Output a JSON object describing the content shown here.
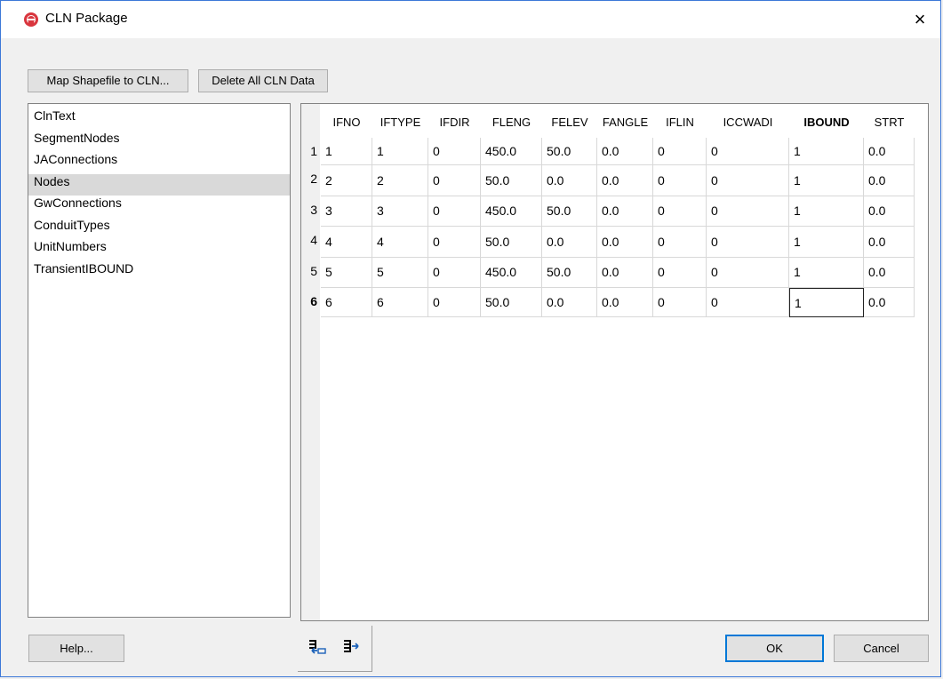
{
  "window": {
    "title": "CLN Package",
    "close_label": "×"
  },
  "toolbar": {
    "map_label": "Map Shapefile to CLN...",
    "delete_label": "Delete All CLN Data"
  },
  "sidebar": {
    "items": [
      {
        "label": "ClnText"
      },
      {
        "label": "SegmentNodes"
      },
      {
        "label": "JAConnections"
      },
      {
        "label": "Nodes"
      },
      {
        "label": "GwConnections"
      },
      {
        "label": "ConduitTypes"
      },
      {
        "label": "UnitNumbers"
      },
      {
        "label": "TransientIBOUND"
      }
    ],
    "selected_index": 3
  },
  "grid": {
    "columns": [
      "IFNO",
      "IFTYPE",
      "IFDIR",
      "FLENG",
      "FELEV",
      "FANGLE",
      "IFLIN",
      "ICCWADI",
      "IBOUND",
      "STRT"
    ],
    "bold_column": "IBOUND",
    "row_labels": [
      "1",
      "2",
      "3",
      "4",
      "5",
      "6"
    ],
    "active_row": "6",
    "active_cell": {
      "row": 5,
      "column": "IBOUND"
    },
    "rows": [
      [
        "1",
        "1",
        "0",
        "450.0",
        "50.0",
        "0.0",
        "0",
        "0",
        "1",
        "0.0"
      ],
      [
        "2",
        "2",
        "0",
        "50.0",
        "0.0",
        "0.0",
        "0",
        "0",
        "1",
        "0.0"
      ],
      [
        "3",
        "3",
        "0",
        "450.0",
        "50.0",
        "0.0",
        "0",
        "0",
        "1",
        "0.0"
      ],
      [
        "4",
        "4",
        "0",
        "50.0",
        "0.0",
        "0.0",
        "0",
        "0",
        "1",
        "0.0"
      ],
      [
        "5",
        "5",
        "0",
        "450.0",
        "50.0",
        "0.0",
        "0",
        "0",
        "1",
        "0.0"
      ],
      [
        "6",
        "6",
        "0",
        "50.0",
        "0.0",
        "0.0",
        "0",
        "0",
        "1",
        "0.0"
      ]
    ]
  },
  "footer": {
    "help_label": "Help...",
    "ok_label": "OK",
    "cancel_label": "Cancel",
    "tools": [
      {
        "icon": "insert-row-icon"
      },
      {
        "icon": "append-row-icon"
      }
    ]
  },
  "colors": {
    "accent": "#0078d7",
    "app_icon": "#d9363e",
    "selected_row": "#d9d9d9"
  }
}
